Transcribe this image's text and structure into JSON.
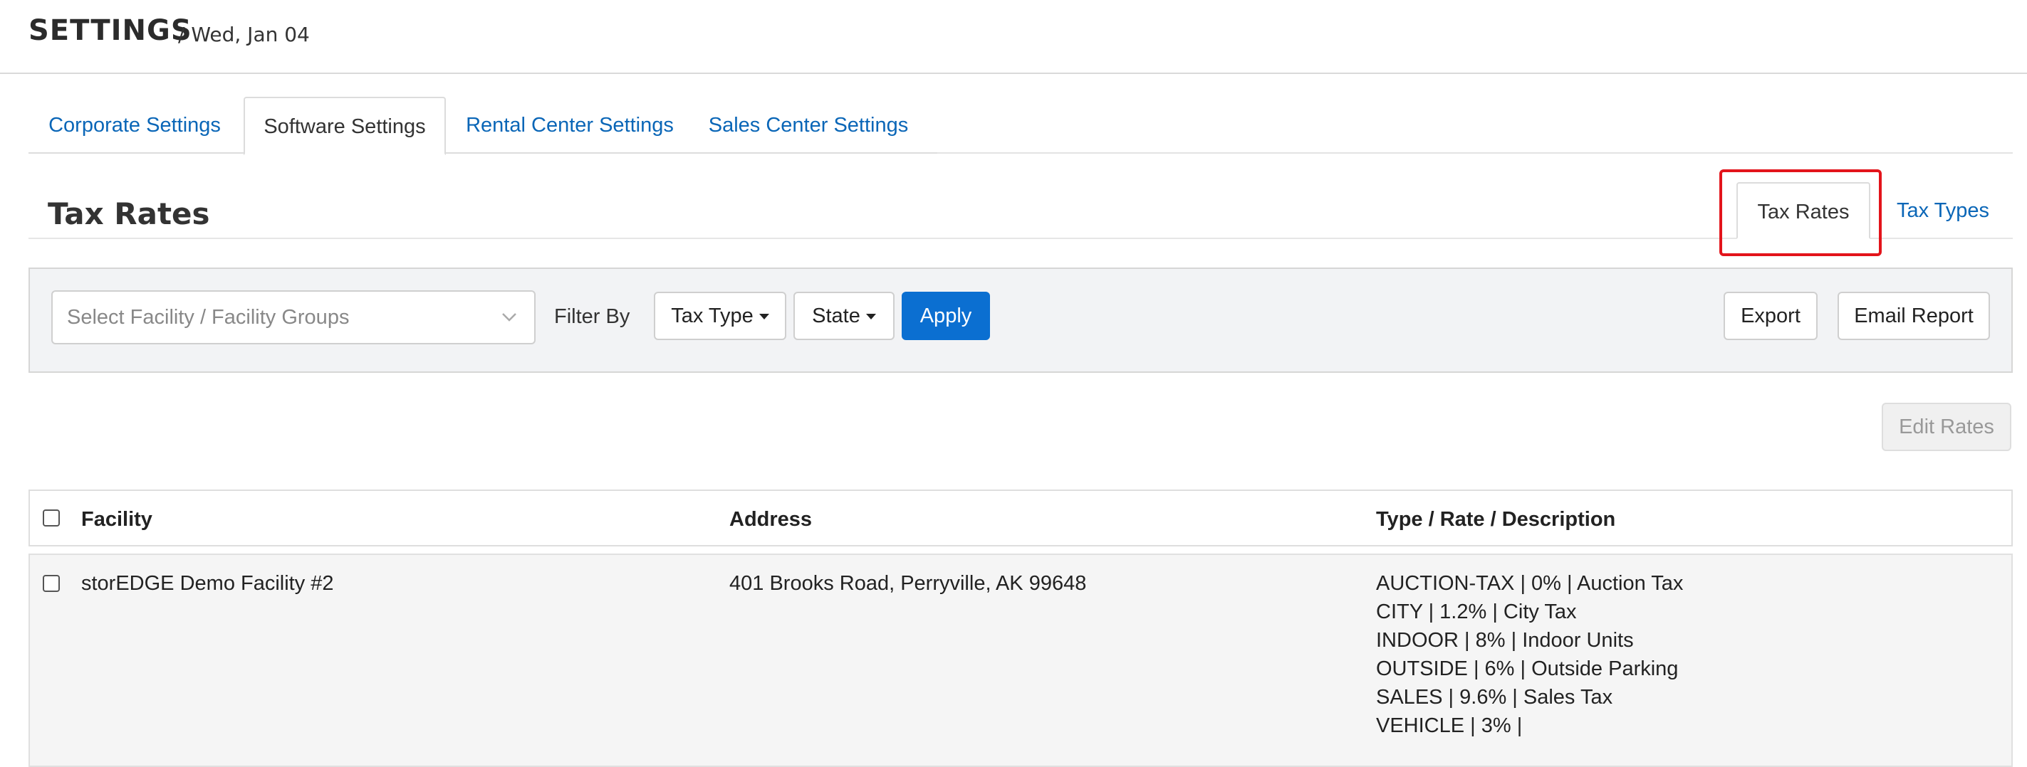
{
  "header": {
    "title": "SETTINGS",
    "date": "/ Wed, Jan 04"
  },
  "main_tabs": [
    {
      "label": "Corporate Settings",
      "active": false
    },
    {
      "label": "Software Settings",
      "active": true
    },
    {
      "label": "Rental Center Settings",
      "active": false
    },
    {
      "label": "Sales Center Settings",
      "active": false
    }
  ],
  "section": {
    "title": "Tax Rates",
    "sub_tabs": [
      {
        "label": "Tax Rates",
        "active": true
      },
      {
        "label": "Tax Types",
        "active": false
      }
    ]
  },
  "filters": {
    "facility_placeholder": "Select Facility / Facility Groups",
    "filter_by_label": "Filter By",
    "tax_type_label": "Tax Type",
    "state_label": "State",
    "apply_label": "Apply",
    "export_label": "Export",
    "email_report_label": "Email Report"
  },
  "edit_rates_label": "Edit Rates",
  "table": {
    "columns": [
      "Facility",
      "Address",
      "Type / Rate / Description"
    ],
    "rows": [
      {
        "facility": "storEDGE Demo Facility #2",
        "address": "401 Brooks Road, Perryville, AK 99648",
        "rates": [
          "AUCTION-TAX | 0% | Auction Tax",
          "CITY | 1.2% | City Tax",
          "INDOOR | 8% | Indoor Units",
          "OUTSIDE | 6% | Outside Parking",
          "SALES | 9.6% | Sales Tax",
          "VEHICLE | 3% |"
        ]
      }
    ]
  },
  "colors": {
    "link": "#0a66b7",
    "primary_button": "#0b6fd1",
    "highlight": "#e3141b",
    "filter_bg": "#f2f3f5"
  }
}
